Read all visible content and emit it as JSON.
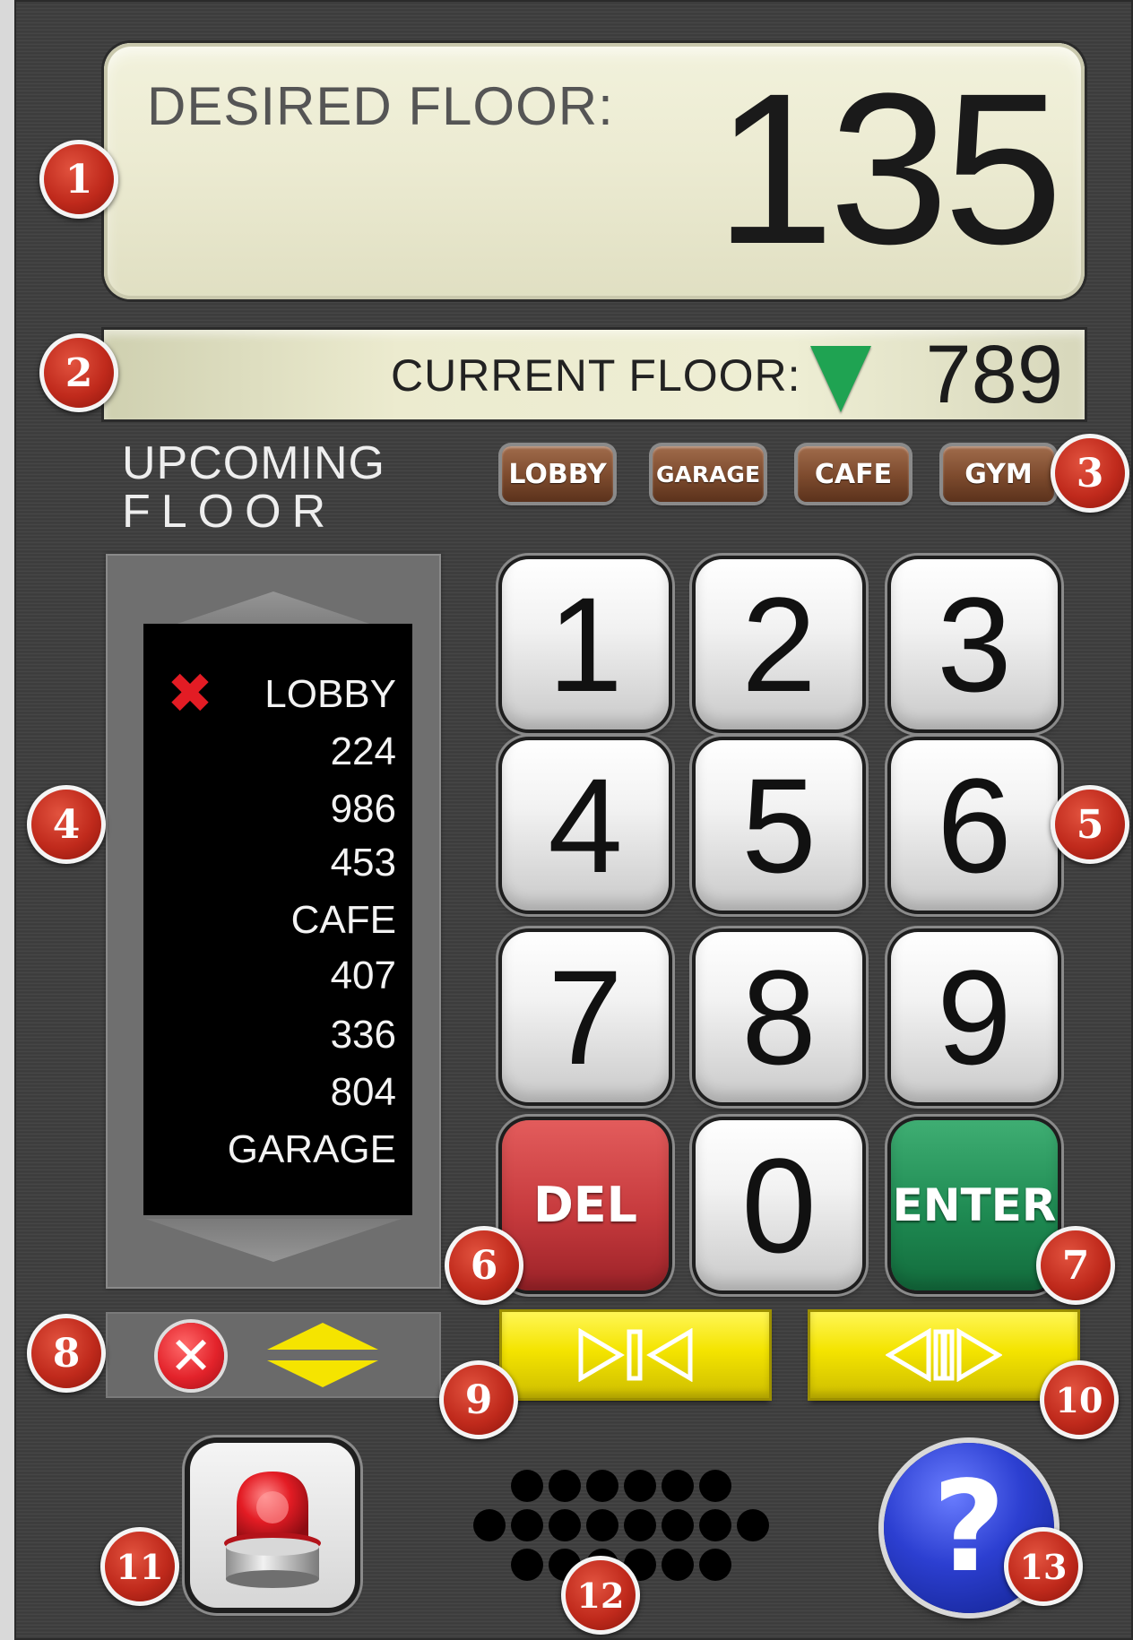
{
  "desired": {
    "label": "DESIRED FLOOR:",
    "value": "135"
  },
  "current": {
    "label": "CURRENT FLOOR:",
    "value": "789",
    "direction_icon": "down-arrow-icon"
  },
  "upcoming": {
    "title_line1": "UPCOMING",
    "title_line2": "FLOOR",
    "items": [
      "LOBBY",
      "224",
      "986",
      "453",
      "CAFE",
      "407",
      "336",
      "804",
      "GARAGE"
    ],
    "remove_icon": "x-icon"
  },
  "shortcuts": [
    "LOBBY",
    "GARAGE",
    "CAFE",
    "GYM"
  ],
  "keypad": {
    "keys": [
      "1",
      "2",
      "3",
      "4",
      "5",
      "6",
      "7",
      "8",
      "9"
    ],
    "zero": "0",
    "del_label": "DEL",
    "enter_label": "ENTER"
  },
  "markers": [
    "1",
    "2",
    "3",
    "4",
    "5",
    "6",
    "7",
    "8",
    "9",
    "10",
    "11",
    "12",
    "13"
  ],
  "controls": {
    "cancel_icon": "cancel-icon",
    "reorder_icon": "up-down-arrows-icon",
    "close_doors_icon": "close-doors-icon",
    "open_doors_icon": "open-doors-icon",
    "alarm_icon": "alarm-siren-icon",
    "speaker_icon": "speaker-grille-icon",
    "help_icon": "help-icon",
    "help_glyph": "?"
  },
  "colors": {
    "panel": "#3e3e3e",
    "display_bg": "#ecebd2",
    "marker": "#c02a1c",
    "down_arrow": "#1fa352",
    "shortcut": "#7c4a2d",
    "del": "#c63a3d",
    "enter": "#1e8a52",
    "door_button": "#f4e400",
    "help": "#2c3fd1"
  }
}
